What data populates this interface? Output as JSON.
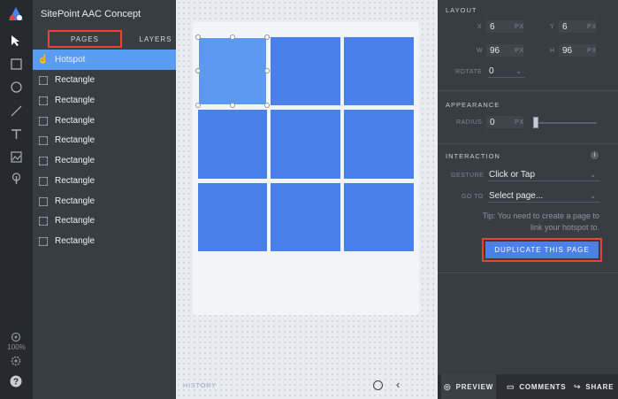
{
  "app": {
    "project_title": "SitePoint AAC Concept",
    "zoom": "100%"
  },
  "left_tabs": {
    "pages": "PAGES",
    "layers": "LAYERS"
  },
  "layers": [
    {
      "label": "Hotspot",
      "active": true
    },
    {
      "label": "Rectangle"
    },
    {
      "label": "Rectangle"
    },
    {
      "label": "Rectangle"
    },
    {
      "label": "Rectangle"
    },
    {
      "label": "Rectangle"
    },
    {
      "label": "Rectangle"
    },
    {
      "label": "Rectangle"
    },
    {
      "label": "Rectangle"
    },
    {
      "label": "Rectangle"
    }
  ],
  "canvas": {
    "history_label": "HISTORY"
  },
  "layout": {
    "title": "LAYOUT",
    "x_label": "X",
    "x_value": "6",
    "y_label": "Y",
    "y_value": "6",
    "w_label": "W",
    "w_value": "96",
    "h_label": "H",
    "h_value": "96",
    "unit": "PX",
    "rotate_label": "ROTATE",
    "rotate_value": "0"
  },
  "appearance": {
    "title": "APPEARANCE",
    "radius_label": "RADIUS",
    "radius_value": "0",
    "unit": "PX"
  },
  "interaction": {
    "title": "INTERACTION",
    "gesture_label": "GESTURE",
    "gesture_value": "Click or Tap",
    "goto_label": "GO TO",
    "goto_value": "Select page...",
    "tip": "Tip: You need to create a page to link your hotspot to.",
    "duplicate_button": "DUPLICATE THIS PAGE"
  },
  "bottom_bar": {
    "preview": "PREVIEW",
    "comments": "COMMENTS",
    "share": "SHARE"
  },
  "colors": {
    "accent": "#4a80ea",
    "highlight": "#e8452c",
    "selected_layer": "#5a9df0"
  }
}
